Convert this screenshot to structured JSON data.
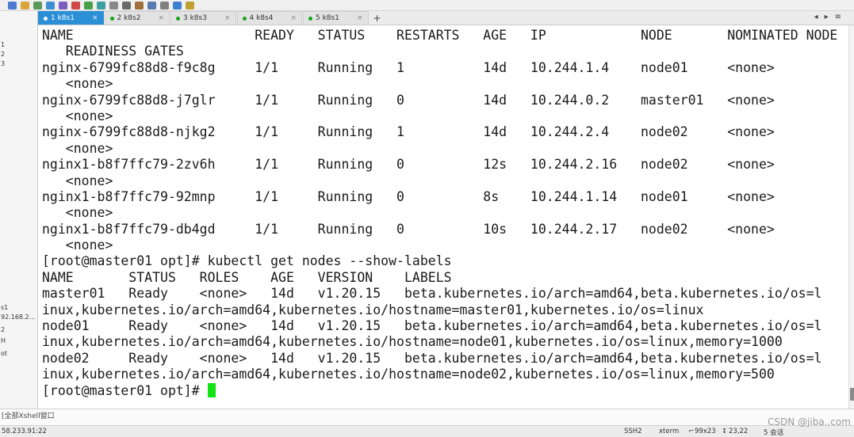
{
  "toolbar": {
    "icons": [
      "new-session-icon",
      "folder-icon",
      "link-icon",
      "globe-icon",
      "font-icon",
      "color-icon",
      "xftp-icon",
      "fullscreen-icon",
      "lock-icon",
      "keyboard-icon",
      "script-icon",
      "layout-icon",
      "settings-icon",
      "help-icon",
      "chat-icon"
    ]
  },
  "sidebar": {
    "fragments": [
      "1",
      "2",
      "3",
      "s1",
      "92.168.2...",
      "2",
      "H",
      "ot"
    ]
  },
  "tabs": [
    {
      "label": "1 k8s1",
      "active": true
    },
    {
      "label": "2 k8s2",
      "active": false
    },
    {
      "label": "3 k8s3",
      "active": false
    },
    {
      "label": "4 k8s4",
      "active": false
    },
    {
      "label": "5 k8s1",
      "active": false
    }
  ],
  "tab_add": "+",
  "terminal": {
    "lines": [
      "NAME                       READY   STATUS    RESTARTS   AGE   IP            NODE       NOMINATED NODE",
      "   READINESS GATES",
      "nginx-6799fc88d8-f9c8g     1/1     Running   1          14d   10.244.1.4    node01     <none>",
      "   <none>",
      "nginx-6799fc88d8-j7glr     1/1     Running   0          14d   10.244.0.2    master01   <none>",
      "   <none>",
      "nginx-6799fc88d8-njkg2     1/1     Running   1          14d   10.244.2.4    node02     <none>",
      "   <none>",
      "nginx1-b8f7ffc79-2zv6h     1/1     Running   0          12s   10.244.2.16   node02     <none>",
      "   <none>",
      "nginx1-b8f7ffc79-92mnp     1/1     Running   0          8s    10.244.1.14   node01     <none>",
      "   <none>",
      "nginx1-b8f7ffc79-db4gd     1/1     Running   0          10s   10.244.2.17   node02     <none>",
      "   <none>",
      "[root@master01 opt]# kubectl get nodes --show-labels",
      "NAME       STATUS   ROLES    AGE   VERSION    LABELS",
      "master01   Ready    <none>   14d   v1.20.15   beta.kubernetes.io/arch=amd64,beta.kubernetes.io/os=l",
      "inux,kubernetes.io/arch=amd64,kubernetes.io/hostname=master01,kubernetes.io/os=linux",
      "node01     Ready    <none>   14d   v1.20.15   beta.kubernetes.io/arch=amd64,beta.kubernetes.io/os=l",
      "inux,kubernetes.io/arch=amd64,kubernetes.io/hostname=node01,kubernetes.io/os=linux,memory=1000",
      "node02     Ready    <none>   14d   v1.20.15   beta.kubernetes.io/arch=amd64,beta.kubernetes.io/os=l",
      "inux,kubernetes.io/arch=amd64,kubernetes.io/hostname=node02,kubernetes.io/os=linux,memory=500"
    ],
    "prompt": "[root@master01 opt]# ",
    "cursor_color": "#13e213"
  },
  "compose": {
    "label": "[全部Xshell窗口"
  },
  "statusbar": {
    "left": "58.233.91:22",
    "protocol": "SSH2",
    "term": "xterm",
    "size": "99x23",
    "pos": "23,22",
    "sessions": "5 会话"
  },
  "watermark": "CSDN @jiba..com",
  "colors": {
    "accent": "#2b8fd6",
    "session_dot": "#19a119"
  }
}
